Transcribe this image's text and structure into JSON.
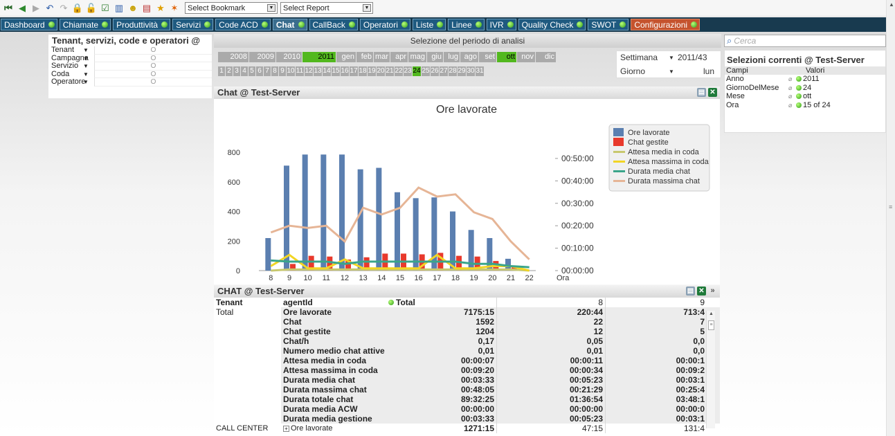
{
  "toolbar": {
    "icons": [
      "first-icon",
      "back-icon",
      "forward-icon",
      "undo-icon",
      "redo-icon",
      "lock-icon",
      "unlock-icon",
      "checklist-icon",
      "chart-icon",
      "users-icon",
      "books-icon",
      "star-icon",
      "clear-icon"
    ],
    "bookmark": "Select Bookmark",
    "report": "Select Report"
  },
  "tabs": [
    {
      "label": "Dashboard"
    },
    {
      "label": "Chiamate"
    },
    {
      "label": "Produttività"
    },
    {
      "label": "Servizi"
    },
    {
      "label": "Code ACD"
    },
    {
      "label": "Chat"
    },
    {
      "label": "CallBack"
    },
    {
      "label": "Operatori"
    },
    {
      "label": "Liste"
    },
    {
      "label": "Linee"
    },
    {
      "label": "IVR"
    },
    {
      "label": "Quality Check"
    },
    {
      "label": "SWOT"
    },
    {
      "label": "Configurazioni"
    }
  ],
  "left_panel": {
    "title": "Tenant, servizi, code e operatori @",
    "rows": [
      {
        "label": "Tenant",
        "value": "O"
      },
      {
        "label": "Campagna",
        "value": "O"
      },
      {
        "label": "Servizio",
        "value": "O"
      },
      {
        "label": "Coda",
        "value": "O"
      },
      {
        "label": "Operatore",
        "value": "O"
      }
    ]
  },
  "period": {
    "title": "Selezione del periodo di analisi",
    "years": [
      "2008",
      "2009",
      "2010",
      "2011"
    ],
    "months": [
      "gen",
      "feb",
      "mar",
      "apr",
      "mag",
      "giu",
      "lug",
      "ago",
      "set",
      "ott",
      "nov",
      "dic"
    ],
    "selected_year": "2011",
    "selected_month": "ott",
    "days": [
      "1",
      "2",
      "3",
      "4",
      "5",
      "6",
      "7",
      "8",
      "9",
      "10",
      "11",
      "12",
      "13",
      "14",
      "15",
      "16",
      "17",
      "18",
      "19",
      "20",
      "21",
      "22",
      "23",
      "24",
      "25",
      "26",
      "27",
      "28",
      "29",
      "30",
      "31"
    ],
    "selected_day": "24",
    "week_label": "Settimana",
    "week_value": "2011/43",
    "day_label": "Giorno",
    "day_value": "lun"
  },
  "chart_panel": {
    "title": "Chat @ Test-Server"
  },
  "chart_data": {
    "type": "bar",
    "title": "Ore lavorate",
    "xlabel": "Ora",
    "categories": [
      "8",
      "9",
      "10",
      "11",
      "12",
      "13",
      "14",
      "15",
      "16",
      "17",
      "18",
      "19",
      "20",
      "21",
      "22"
    ],
    "y_ticks": [
      "0",
      "200",
      "400",
      "600",
      "800"
    ],
    "ylim": [
      0,
      880
    ],
    "y2_ticks": [
      "00:00:00",
      "00:10:00",
      "00:20:00",
      "00:30:00",
      "00:40:00",
      "00:50:00"
    ],
    "y2lim_minutes": [
      0,
      58
    ],
    "series": [
      {
        "name": "Ore lavorate",
        "kind": "bar",
        "color": "#5b7fb0",
        "values": [
          220,
          710,
          785,
          785,
          785,
          685,
          695,
          530,
          490,
          495,
          400,
          275,
          220,
          80,
          0
        ]
      },
      {
        "name": "Chat gestite",
        "kind": "bar",
        "color": "#e8392c",
        "values": [
          0,
          45,
          100,
          95,
          75,
          90,
          115,
          115,
          110,
          120,
          100,
          95,
          65,
          35,
          0
        ]
      },
      {
        "name": "Attesa media in coda",
        "kind": "line",
        "color": "#c8c86e",
        "minutes": [
          0,
          0.5,
          0.5,
          0.5,
          0.5,
          0.5,
          0.5,
          0.5,
          0.5,
          0.5,
          0.5,
          0.5,
          0.5,
          0.5,
          0
        ]
      },
      {
        "name": "Attesa massima in coda",
        "kind": "line",
        "color": "#f2d524",
        "minutes": [
          2,
          7,
          1,
          1,
          5,
          1,
          1,
          1,
          1,
          7,
          1,
          1,
          2,
          2,
          0
        ]
      },
      {
        "name": "Durata media chat",
        "kind": "line",
        "color": "#3aa58a",
        "minutes": [
          4.5,
          4,
          4,
          4,
          3,
          4,
          4,
          4,
          4,
          4,
          4,
          3,
          3,
          2,
          1.5
        ]
      },
      {
        "name": "Durata massima chat",
        "kind": "line",
        "color": "#e6b596",
        "minutes": [
          17,
          20,
          19,
          20,
          13,
          28,
          25,
          28,
          37,
          33,
          34,
          26,
          23,
          13,
          5
        ]
      }
    ],
    "legend_position": "right"
  },
  "table_panel": {
    "title": "CHAT @ Test-Server",
    "header": [
      "Tenant",
      "agentId",
      "Total",
      "8",
      "9"
    ],
    "group_label": "Total",
    "rows": [
      {
        "metric": "Ore lavorate",
        "total": "7175:15",
        "h8": "220:44",
        "h9": "713:4"
      },
      {
        "metric": "Chat",
        "total": "1592",
        "h8": "22",
        "h9": "7"
      },
      {
        "metric": "Chat gestite",
        "total": "1204",
        "h8": "12",
        "h9": "5"
      },
      {
        "metric": "Chat/h",
        "total": "0,17",
        "h8": "0,05",
        "h9": "0,0"
      },
      {
        "metric": "Numero medio chat attive",
        "total": "0,01",
        "h8": "0,01",
        "h9": "0,0"
      },
      {
        "metric": "Attesa media in coda",
        "total": "00:00:07",
        "h8": "00:00:11",
        "h9": "00:00:1"
      },
      {
        "metric": "Attesa massima in coda",
        "total": "00:09:20",
        "h8": "00:00:34",
        "h9": "00:09:2"
      },
      {
        "metric": "Durata media chat",
        "total": "00:03:33",
        "h8": "00:05:23",
        "h9": "00:03:1"
      },
      {
        "metric": "Durata massima chat",
        "total": "00:48:05",
        "h8": "00:21:29",
        "h9": "00:25:4"
      },
      {
        "metric": "Durata totale chat",
        "total": "89:32:25",
        "h8": "01:36:54",
        "h9": "03:48:1"
      },
      {
        "metric": "Durata media ACW",
        "total": "00:00:00",
        "h8": "00:00:00",
        "h9": "00:00:0"
      },
      {
        "metric": "Durata media gestione",
        "total": "00:03:33",
        "h8": "00:05:23",
        "h9": "00:03:1"
      }
    ],
    "last_row": {
      "tenant": "CALL CENTER",
      "metric": "Ore lavorate",
      "total": "1271:15",
      "h8": "47:15",
      "h9": "131:4"
    }
  },
  "search": {
    "placeholder": "Cerca"
  },
  "current_selections": {
    "title": "Selezioni correnti @ Test-Server",
    "col_field": "Campi",
    "col_values": "Valori",
    "rows": [
      {
        "field": "Anno",
        "value": "2011"
      },
      {
        "field": "GiornoDelMese",
        "value": "24"
      },
      {
        "field": "Mese",
        "value": "ott"
      },
      {
        "field": "Ora",
        "value": "15 of 24"
      }
    ]
  }
}
